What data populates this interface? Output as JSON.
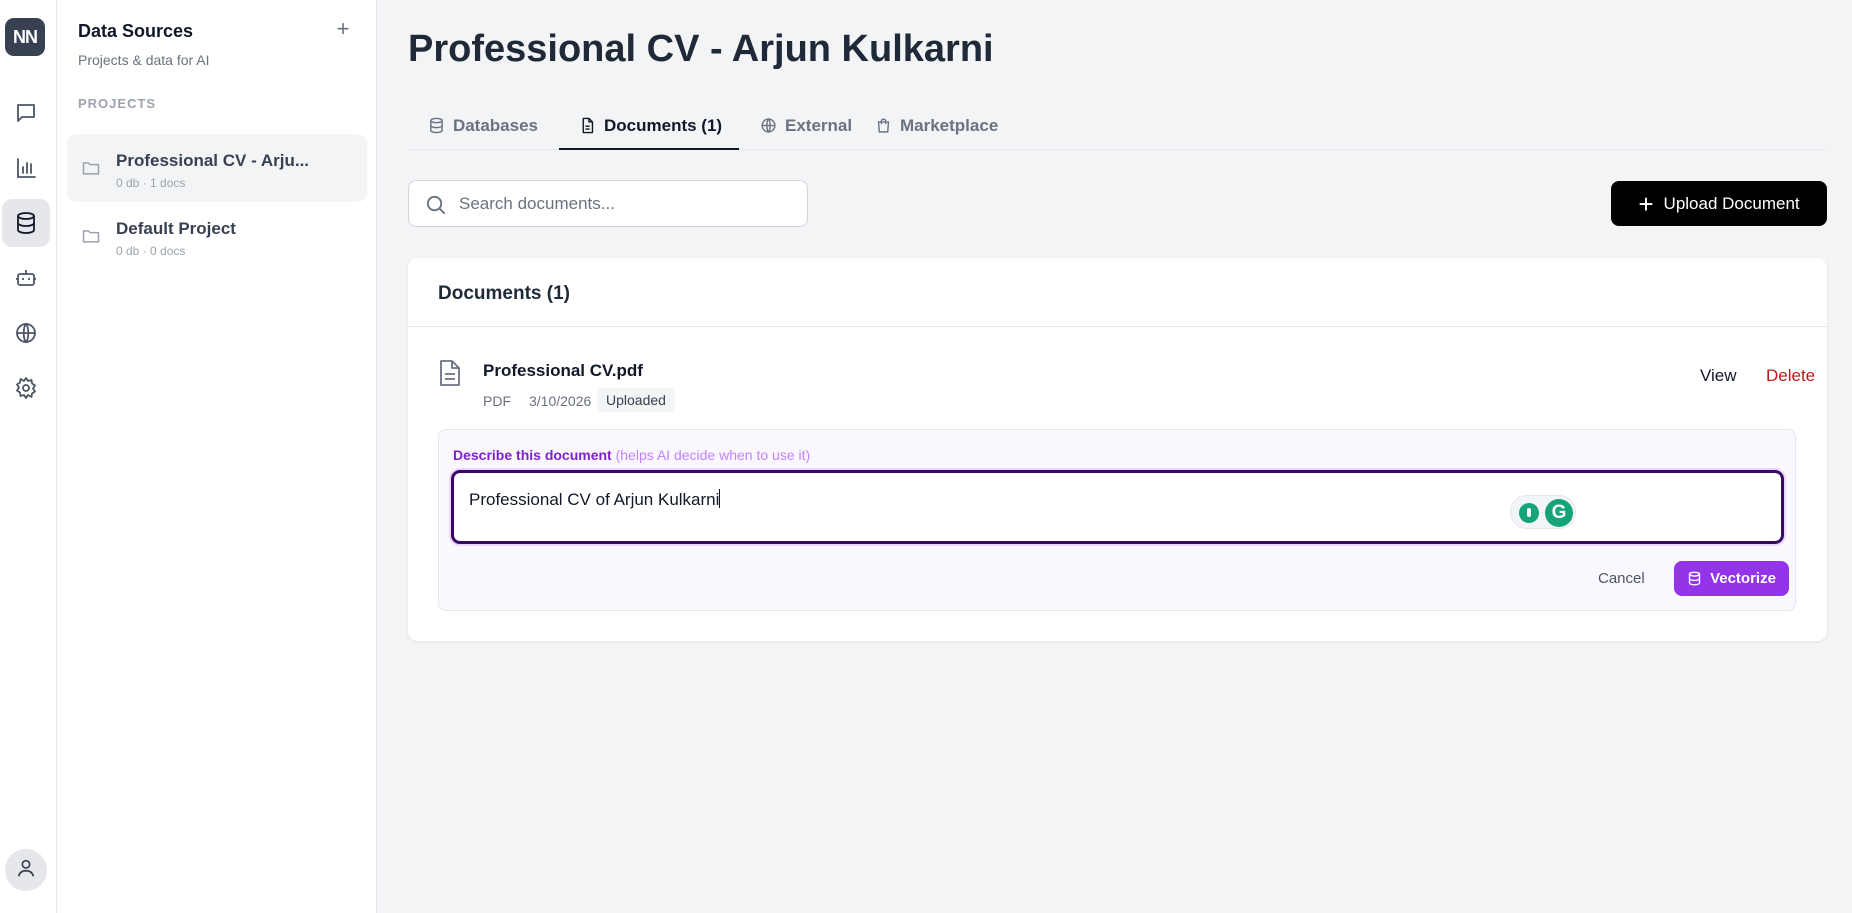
{
  "rail": {
    "logo_text": "NN",
    "items": [
      {
        "icon": "chat-icon",
        "active": false
      },
      {
        "icon": "bar-chart-icon",
        "active": false
      },
      {
        "icon": "database-icon",
        "active": true
      },
      {
        "icon": "bot-icon",
        "active": false
      },
      {
        "icon": "globe-icon",
        "active": false
      },
      {
        "icon": "gear-icon",
        "active": false
      }
    ],
    "user_icon": "user-icon"
  },
  "sidebar": {
    "title": "Data Sources",
    "subtitle": "Projects & data for AI",
    "add_label": "+",
    "section_label": "PROJECTS",
    "projects": [
      {
        "name": "Professional CV - Arju...",
        "meta": "0 db · 1 docs",
        "active": true
      },
      {
        "name": "Default Project",
        "meta": "0 db · 0 docs",
        "active": false
      }
    ]
  },
  "main": {
    "title": "Professional CV - Arjun Kulkarni",
    "tabs": [
      {
        "label": "Databases",
        "icon": "database-icon",
        "active": false
      },
      {
        "label": "Documents (1)",
        "icon": "file-icon",
        "active": true
      },
      {
        "label": "External",
        "icon": "globe-icon",
        "active": false
      },
      {
        "label": "Marketplace",
        "icon": "shopping-bag-icon",
        "active": false
      }
    ],
    "search": {
      "placeholder": "Search documents...",
      "value": ""
    },
    "upload_label": "Upload Document",
    "documents_card": {
      "title": "Documents (1)",
      "document": {
        "name": "Professional CV.pdf",
        "type": "PDF",
        "date": "3/10/2026",
        "status": "Uploaded",
        "view_label": "View",
        "delete_label": "Delete"
      },
      "describe": {
        "label": "Describe this document",
        "hint": "(helps AI decide when to use it)",
        "value": "Professional CV of Arjun Kulkarni",
        "cancel_label": "Cancel",
        "vectorize_label": "Vectorize"
      }
    }
  },
  "colors": {
    "accent_purple": "#9333ea",
    "delete_red": "#b91c1c",
    "focus_border": "#3b0764",
    "grammarly_green": "#15a37a"
  }
}
